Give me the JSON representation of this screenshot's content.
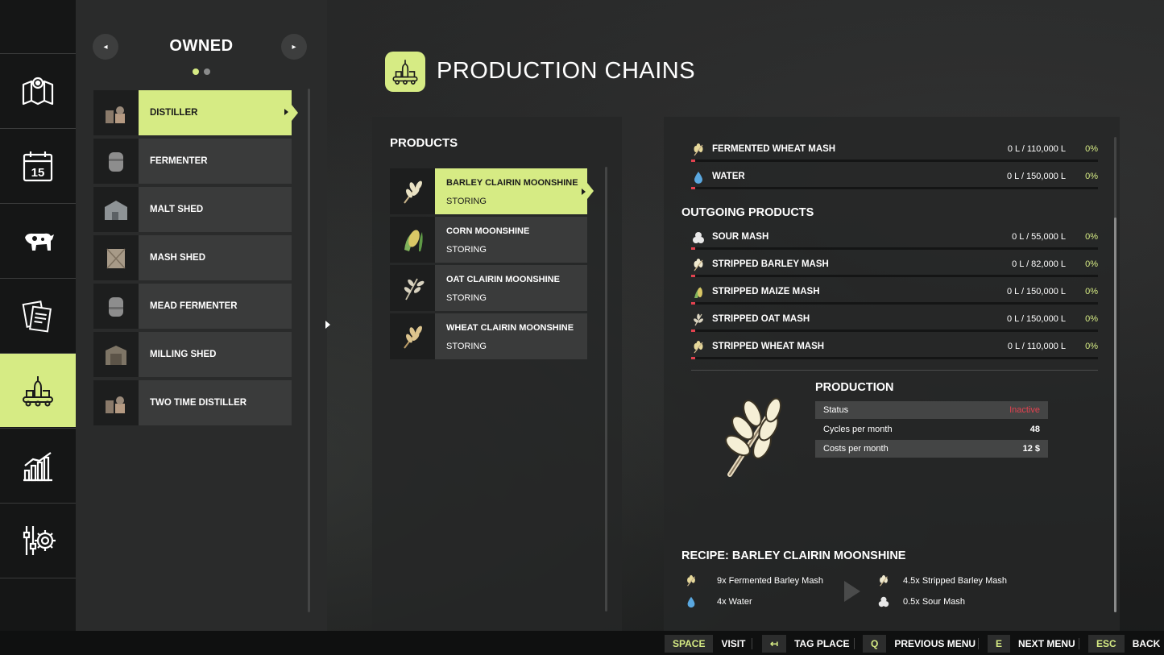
{
  "nav": {
    "items": [
      {
        "name": "map-icon"
      },
      {
        "name": "calendar-icon",
        "text": "15"
      },
      {
        "name": "animals-icon"
      },
      {
        "name": "contracts-icon"
      },
      {
        "name": "production-icon"
      },
      {
        "name": "statistics-icon"
      },
      {
        "name": "settings-icon"
      }
    ],
    "active_index": 4
  },
  "owned": {
    "title": "OWNED",
    "prev_label": "◂",
    "next_label": "▸",
    "items": [
      {
        "label": "DISTILLER",
        "selected": true
      },
      {
        "label": "FERMENTER"
      },
      {
        "label": "MALT SHED"
      },
      {
        "label": "MASH SHED"
      },
      {
        "label": "MEAD FERMENTER"
      },
      {
        "label": "MILLING SHED"
      },
      {
        "label": "TWO TIME DISTILLER"
      }
    ]
  },
  "page": {
    "title": "PRODUCTION CHAINS"
  },
  "products": {
    "heading": "PRODUCTS",
    "items": [
      {
        "name": "BARLEY CLAIRIN MOONSHINE",
        "state": "STORING",
        "selected": true
      },
      {
        "name": "CORN MOONSHINE",
        "state": "STORING"
      },
      {
        "name": "OAT CLAIRIN MOONSHINE",
        "state": "STORING"
      },
      {
        "name": "WHEAT CLAIRIN MOONSHINE",
        "state": "STORING"
      }
    ]
  },
  "incoming": [
    {
      "name": "FERMENTED WHEAT MASH",
      "amount": "0 L / 110,000 L",
      "percent": "0%",
      "fill": 0
    },
    {
      "name": "WATER",
      "amount": "0 L / 150,000 L",
      "percent": "0%",
      "fill": 0
    }
  ],
  "outgoing": {
    "heading": "OUTGOING PRODUCTS",
    "items": [
      {
        "name": "SOUR MASH",
        "amount": "0 L / 55,000 L",
        "percent": "0%",
        "fill": 0
      },
      {
        "name": "STRIPPED BARLEY MASH",
        "amount": "0 L / 82,000 L",
        "percent": "0%",
        "fill": 0
      },
      {
        "name": "STRIPPED MAIZE MASH",
        "amount": "0 L / 150,000 L",
        "percent": "0%",
        "fill": 0
      },
      {
        "name": "STRIPPED OAT MASH",
        "amount": "0 L / 150,000 L",
        "percent": "0%",
        "fill": 0
      },
      {
        "name": "STRIPPED WHEAT MASH",
        "amount": "0 L / 110,000 L",
        "percent": "0%",
        "fill": 0
      }
    ]
  },
  "production": {
    "heading": "PRODUCTION",
    "status_label": "Status",
    "status_value": "Inactive",
    "cycles_label": "Cycles per month",
    "cycles_value": "48",
    "costs_label": "Costs per month",
    "costs_value": "12 $"
  },
  "recipe": {
    "heading": "RECIPE: BARLEY CLAIRIN MOONSHINE",
    "inputs": [
      "9x Fermented Barley Mash",
      "4x Water"
    ],
    "outputs": [
      "4.5x Stripped Barley Mash",
      "0.5x Sour Mash"
    ]
  },
  "bottom_bar": {
    "hints": [
      {
        "key": "SPACE",
        "label": "VISIT"
      },
      {
        "key": "↤",
        "label": "TAG PLACE"
      },
      {
        "key": "Q",
        "label": "PREVIOUS MENU"
      },
      {
        "key": "E",
        "label": "NEXT MENU"
      },
      {
        "key": "ESC",
        "label": "BACK"
      }
    ]
  },
  "colors": {
    "accent": "#d6eb84",
    "inactive": "#e2424f",
    "fill_bar": "#e2424f"
  }
}
